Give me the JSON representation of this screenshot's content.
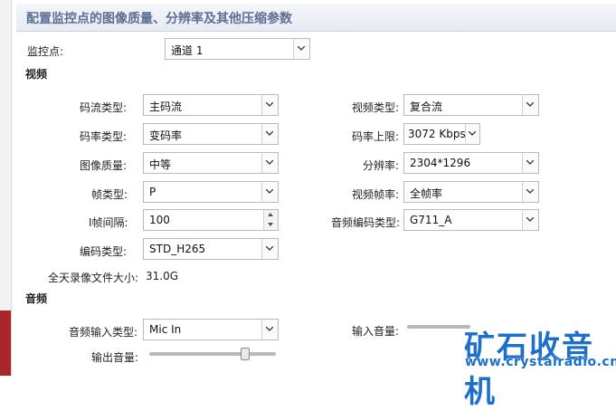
{
  "header": {
    "title": "配置监控点的图像质量、分辨率及其他压缩参数"
  },
  "channel": {
    "label": "监控点:",
    "value": "通道 1"
  },
  "video": {
    "section": "视频",
    "stream_type": {
      "label": "码流类型:",
      "value": "主码流"
    },
    "video_type": {
      "label": "视频类型:",
      "value": "复合流"
    },
    "bitrate_type": {
      "label": "码率类型:",
      "value": "变码率"
    },
    "bitrate_limit": {
      "label": "码率上限:",
      "value": "3072 Kbps"
    },
    "image_quality": {
      "label": "图像质量:",
      "value": "中等"
    },
    "resolution": {
      "label": "分辨率:",
      "value": "2304*1296"
    },
    "frame_type": {
      "label": "帧类型:",
      "value": "P"
    },
    "frame_rate": {
      "label": "视频帧率:",
      "value": "全帧率"
    },
    "i_frame_interval": {
      "label": "I帧间隔:",
      "value": "100"
    },
    "audio_encoding": {
      "label": "音频编码类型:",
      "value": "G711_A"
    },
    "encoding_type": {
      "label": "编码类型:",
      "value": "STD_H265"
    },
    "daily_size": {
      "label": "全天录像文件大小:",
      "value": "31.0G"
    }
  },
  "audio": {
    "section": "音频",
    "input_type": {
      "label": "音频输入类型:",
      "value": "Mic In"
    },
    "input_volume": {
      "label": "输入音量:",
      "level": 0.95
    },
    "output_volume": {
      "label": "输出音量:",
      "level": 0.78
    }
  },
  "watermark": {
    "text": "矿石收音机",
    "url": "www.crystalradio.cn"
  },
  "colors": {
    "header_text": "#5b6f94",
    "accent_red": "#a8262a",
    "watermark": "#1d6fc7"
  }
}
